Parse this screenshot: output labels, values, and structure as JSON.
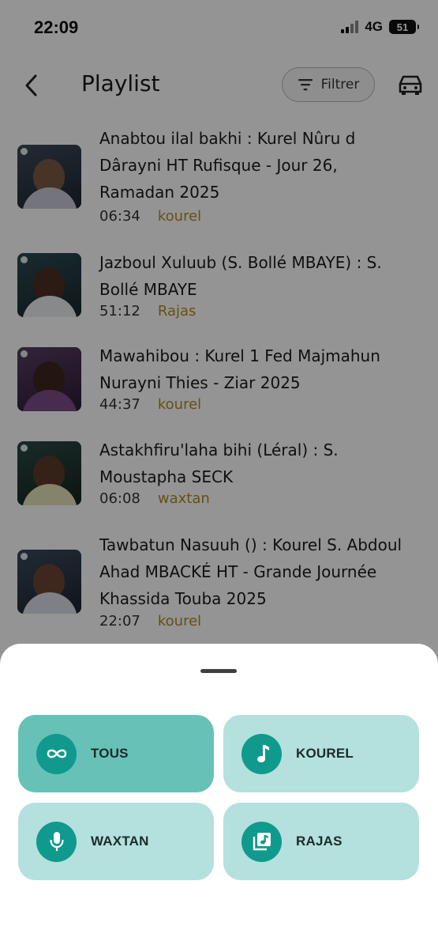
{
  "status_bar": {
    "time": "22:09",
    "network": "4G",
    "battery": "51"
  },
  "header": {
    "title": "Playlist",
    "filter_label": "Filtrer"
  },
  "playlist": [
    {
      "title": "Anabtou ilal bakhi : Kurel Nûru d Dârayni HT Rufisque - Jour 26, Ramadan 2025",
      "duration": "06:34",
      "category": "kourel"
    },
    {
      "title": "Jazboul Xuluub (S. Bollé MBAYE) : S. Bollé MBAYE",
      "duration": "51:12",
      "category": "Rajas"
    },
    {
      "title": "Mawahibou : Kurel 1 Fed Majmahun Nurayni Thies - Ziar 2025",
      "duration": "44:37",
      "category": "kourel"
    },
    {
      "title": "Astakhfiru'laha bihi (Léral) : S. Moustapha SECK",
      "duration": "06:08",
      "category": "waxtan"
    },
    {
      "title": "Tawbatun Nasuuh () : Kourel S. Abdoul Ahad MBACKÉ HT -  Grande Journée Khassida Touba 2025",
      "duration": "22:07",
      "category": "kourel"
    }
  ],
  "filter_sheet": {
    "options": [
      {
        "label": "TOUS",
        "icon": "infinity-icon",
        "selected": true
      },
      {
        "label": "KOUREL",
        "icon": "music-note-icon",
        "selected": false
      },
      {
        "label": "WAXTAN",
        "icon": "microphone-icon",
        "selected": false
      },
      {
        "label": "RAJAS",
        "icon": "music-library-icon",
        "selected": false
      }
    ]
  },
  "colors": {
    "accent": "#0f9a8d",
    "selected_option": "#68c1b7",
    "option": "#b4e0dd",
    "category_text": "#b08a1e"
  }
}
